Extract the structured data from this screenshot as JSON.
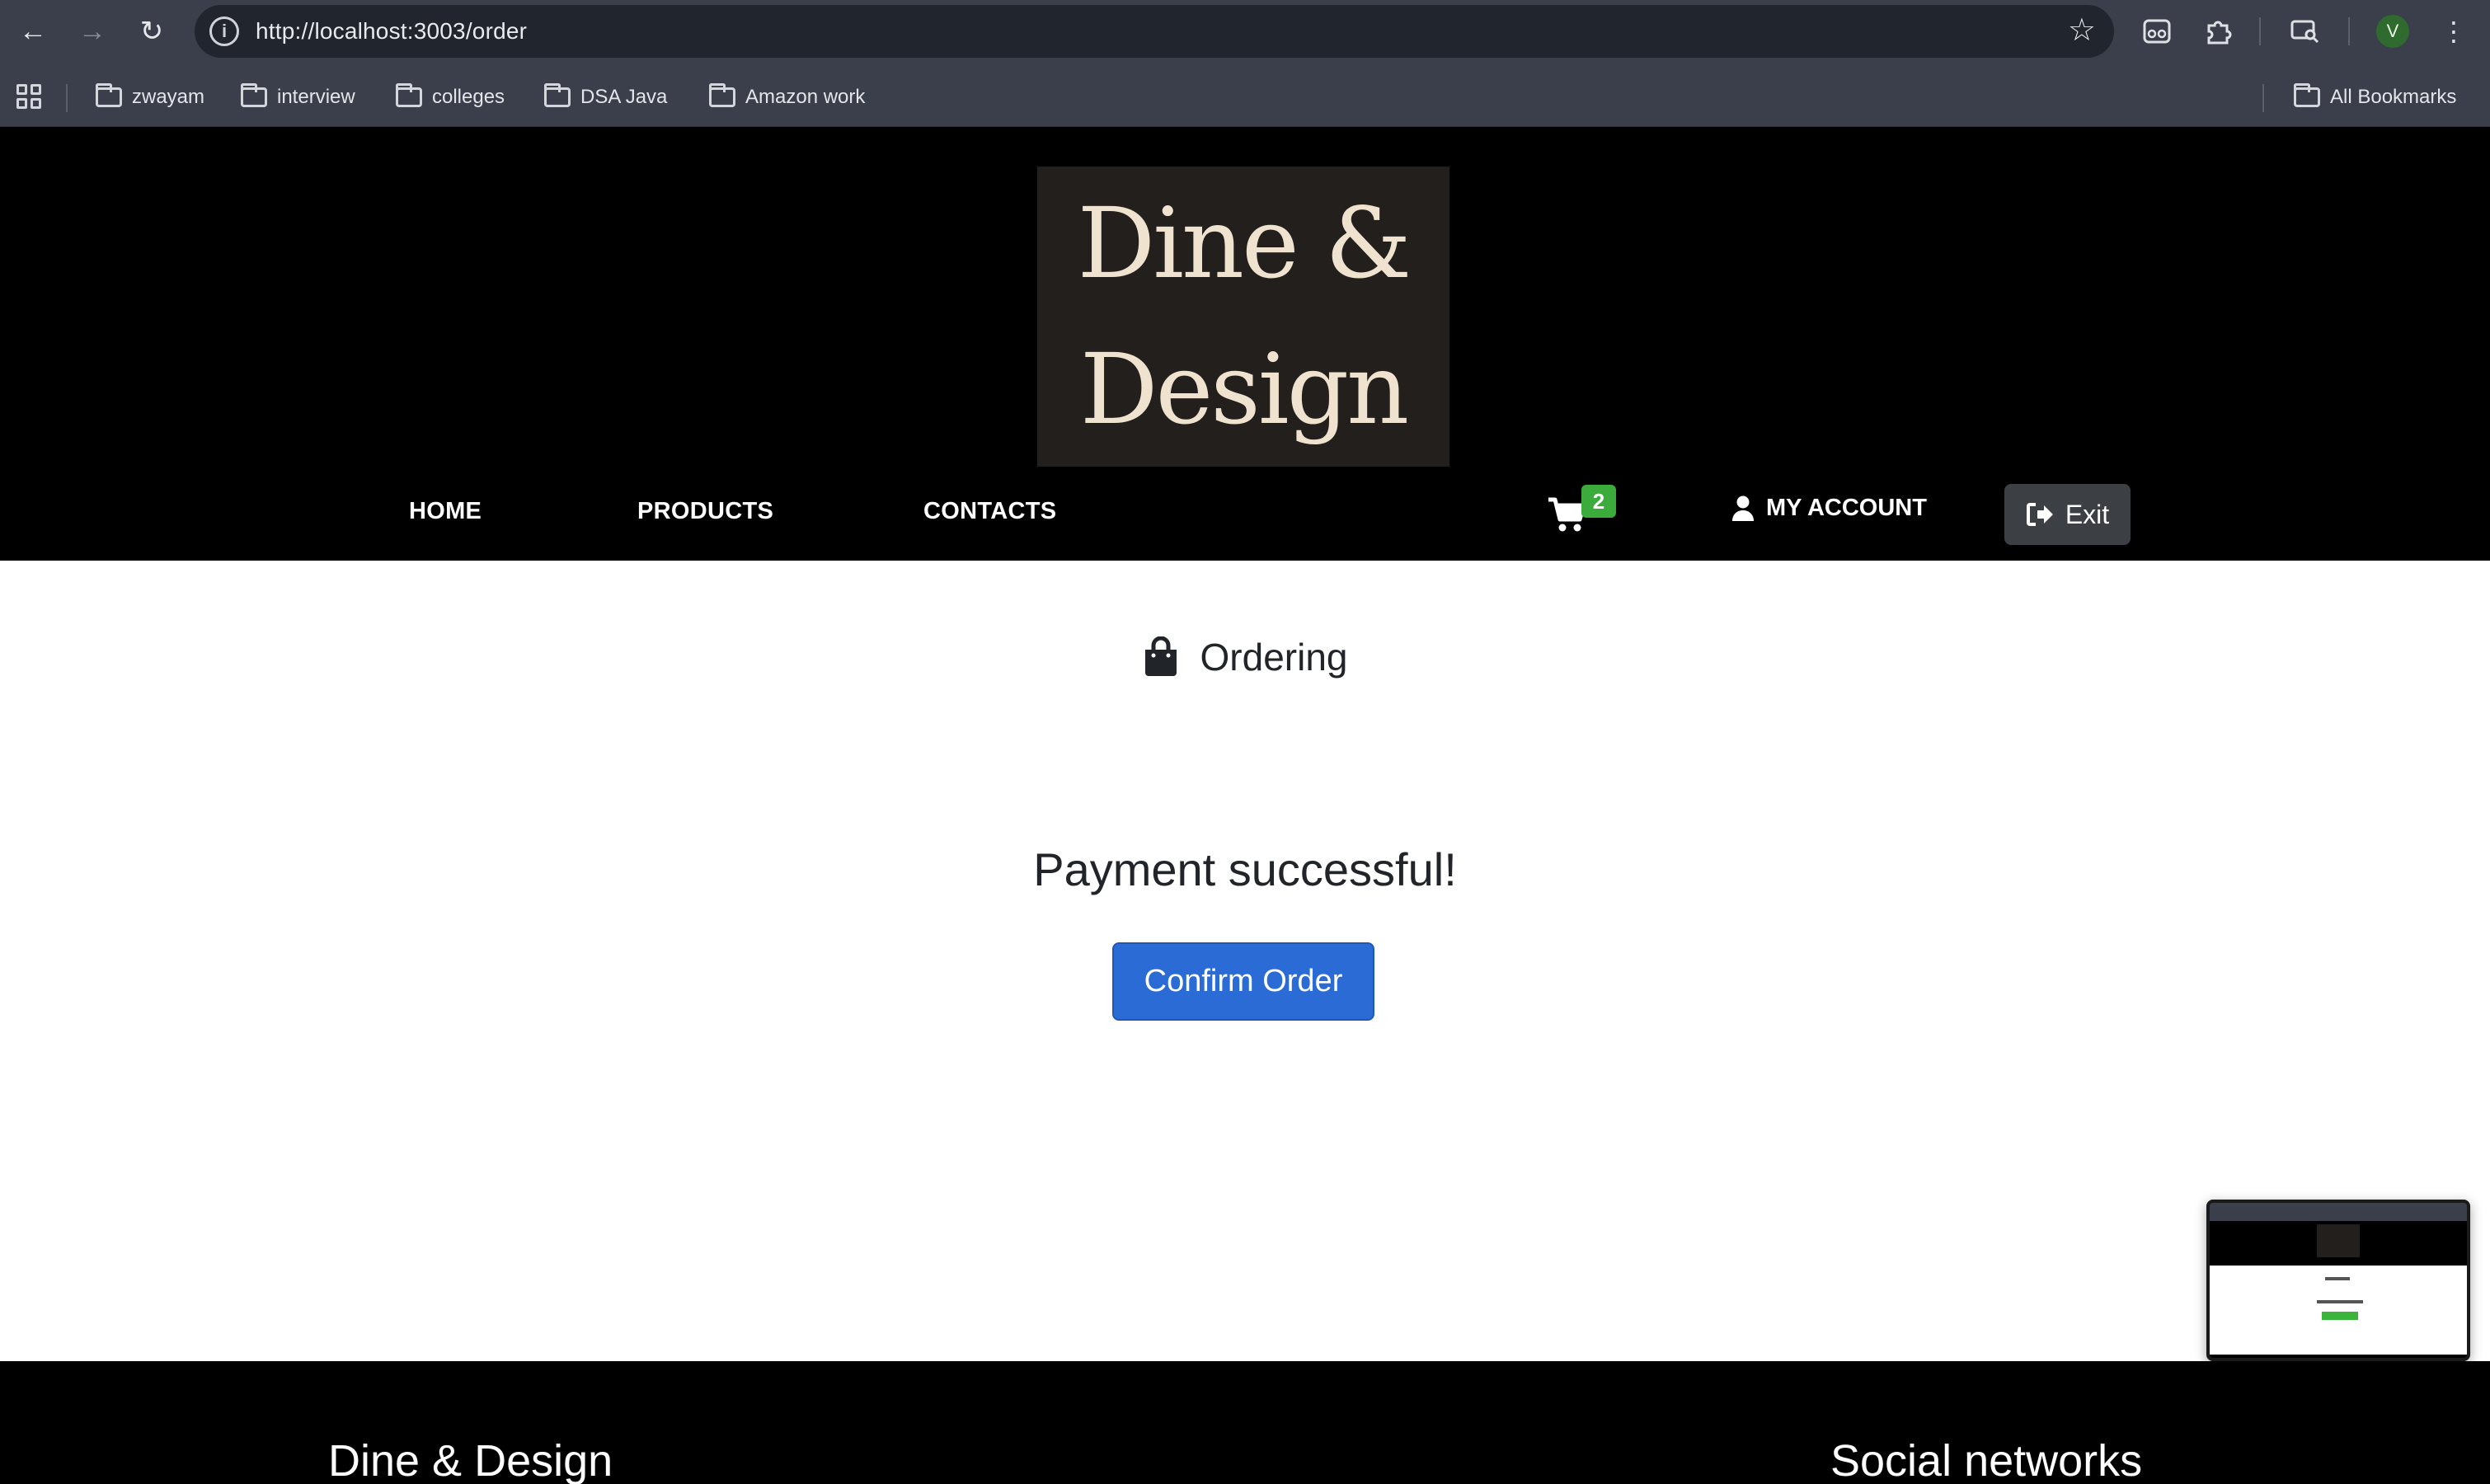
{
  "browser": {
    "url": "http://localhost:3003/order",
    "profile_initial": "V",
    "bookmarks": [
      "zwayam",
      "interview",
      "colleges",
      "DSA Java",
      "Amazon work"
    ],
    "all_bookmarks_label": "All Bookmarks"
  },
  "site": {
    "logo_line1": "Dine &",
    "logo_line2": "Design",
    "nav": {
      "home": "HOME",
      "products": "PRODUCTS",
      "contacts": "CONTACTS",
      "cart_count": "2",
      "account": "MY ACCOUNT",
      "exit": "Exit"
    }
  },
  "main": {
    "title": "Ordering",
    "message": "Payment successful!",
    "confirm_button": "Confirm Order"
  },
  "footer": {
    "brand": "Dine & Design",
    "social_heading": "Social networks"
  },
  "colors": {
    "primary_button": "#2a6bd6",
    "badge": "#3bab3b",
    "header_bg": "#000000",
    "logo_bg": "#231f1c"
  }
}
